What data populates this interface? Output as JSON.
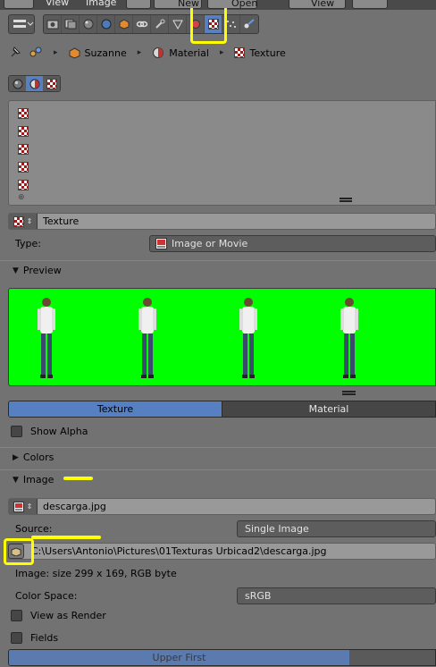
{
  "topbar": {
    "view": "View",
    "image": "Image",
    "new": "New",
    "open": "Open",
    "view2": "View"
  },
  "breadcrumb": {
    "object": "Suzanne",
    "material": "Material",
    "texture": "Texture"
  },
  "texture_block": {
    "name": "Texture",
    "type_label": "Type:",
    "type_value": "Image or Movie"
  },
  "preview": {
    "header": "Preview",
    "tabs": [
      "Texture",
      "Material"
    ],
    "show_alpha": "Show Alpha"
  },
  "colors": {
    "header": "Colors"
  },
  "image": {
    "header": "Image",
    "name": "descarga.jpg",
    "source_label": "Source:",
    "source_value": "Single Image",
    "path": "C:\\Users\\Antonio\\Pictures\\01Texturas Urbicad2\\descarga.jpg",
    "info": "Image: size 299 x 169, RGB byte",
    "colorspace_label": "Color Space:",
    "colorspace_value": "sRGB",
    "view_as_render": "View as Render",
    "fields": "Fields",
    "upper_first": "Upper First"
  },
  "colors_palette": {
    "accent": "#5680c2",
    "highlight": "#ffff00",
    "preview_bg": "#00ff00"
  }
}
